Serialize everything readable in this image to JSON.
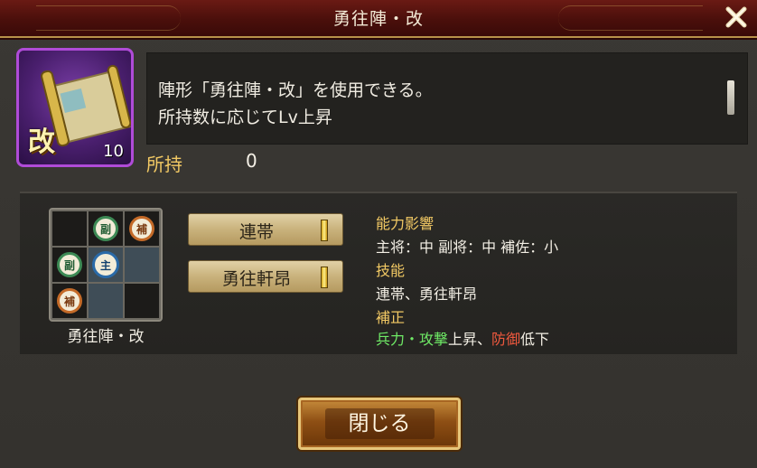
{
  "title": "勇往陣・改",
  "item": {
    "badge": "改",
    "count": "10"
  },
  "description": {
    "line1": "陣形「勇往陣・改」を使用できる。",
    "line2": "所持数に応じてLv上昇"
  },
  "owned": {
    "label": "所持",
    "value": "0"
  },
  "formation": {
    "name": "勇往陣・改",
    "grid": [
      [
        "",
        "副",
        "補"
      ],
      [
        "副",
        "主",
        ""
      ],
      [
        "補",
        "",
        ""
      ]
    ],
    "sub_glyph": "副",
    "aide_glyph": "補",
    "main_glyph": "主"
  },
  "skills": [
    {
      "label": "連帯"
    },
    {
      "label": "勇往軒昂"
    }
  ],
  "info": {
    "influence_head": "能力影響",
    "influence_text": "主将：中 副将：中 補佐：小",
    "skill_head": "技能",
    "skill_text": "連帯、勇往軒昂",
    "bonus_head": "補正",
    "bonus_up": "兵力・攻撃",
    "bonus_up_suffix": "上昇、",
    "bonus_down": "防御",
    "bonus_down_suffix": "低下"
  },
  "buttons": {
    "close": "閉じる"
  },
  "colors": {
    "accent_gold": "#f2c964",
    "up_green": "#6fea66",
    "down_red": "#f0593e",
    "title_red": "#5a140f",
    "rarity_purple": "#b04bd8"
  }
}
